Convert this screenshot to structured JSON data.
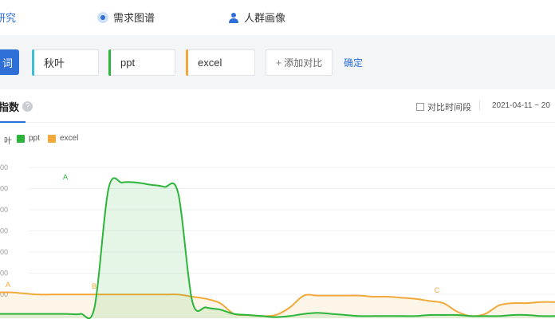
{
  "nav": {
    "items": [
      {
        "label": "研究",
        "active": true
      },
      {
        "label": "需求图谱",
        "icon": "radar-icon"
      },
      {
        "label": "人群画像",
        "icon": "user-icon"
      }
    ]
  },
  "compare": {
    "primary_label": "词",
    "keywords": [
      {
        "label": "秋叶",
        "color": "#3cbfd9"
      },
      {
        "label": "ppt",
        "color": "#2bb53a"
      },
      {
        "label": "excel",
        "color": "#f2a93b"
      }
    ],
    "add_label": "添加对比",
    "confirm_label": "确定"
  },
  "chart_header": {
    "title": "指数",
    "help": "?",
    "compare_period_label": "对比时间段",
    "date_range": "2021-04-11 ~ 20"
  },
  "chart_data": {
    "type": "area",
    "y_tick_labels": [
      "00",
      "00",
      "00",
      "00",
      "00",
      "00",
      "00"
    ],
    "legend": [
      {
        "name": "叶",
        "color": "#3cbfd9"
      },
      {
        "name": "ppt",
        "color": "#2bb53a"
      },
      {
        "name": "excel",
        "color": "#f2a93b"
      }
    ],
    "grid": true,
    "series": [
      {
        "name": "ppt",
        "color": "#2bb53a",
        "values": [
          2,
          2,
          2,
          2,
          2,
          2,
          2,
          5,
          60,
          63,
          63,
          62,
          61,
          58,
          8,
          5,
          4,
          2,
          1.5,
          1,
          0.5,
          1,
          2,
          2.5,
          2,
          1.5,
          1,
          1,
          1,
          1,
          1,
          1.5,
          1.5,
          1.5,
          1,
          1,
          1,
          1.5,
          1.5,
          1,
          1
        ]
      },
      {
        "name": "excel",
        "color": "#f2a93b",
        "values": [
          12,
          12,
          11.5,
          11,
          11,
          11,
          11,
          11,
          11,
          11,
          11,
          11,
          11,
          11,
          10,
          9,
          7,
          2,
          1.5,
          1,
          1.5,
          5,
          10.5,
          10.5,
          10.5,
          10.5,
          10.5,
          10,
          10,
          9.5,
          9,
          8,
          7,
          3,
          1,
          2,
          6,
          7,
          7,
          7.5,
          7.5
        ]
      }
    ],
    "annotations": [
      {
        "label": "A",
        "series": "ppt",
        "index": 9
      },
      {
        "label": "A",
        "series": "excel",
        "index": 0
      },
      {
        "label": "B",
        "series": "excel",
        "index": 12
      },
      {
        "label": "C",
        "series": "excel",
        "index": 58
      }
    ],
    "ylim": [
      0,
      70
    ]
  }
}
